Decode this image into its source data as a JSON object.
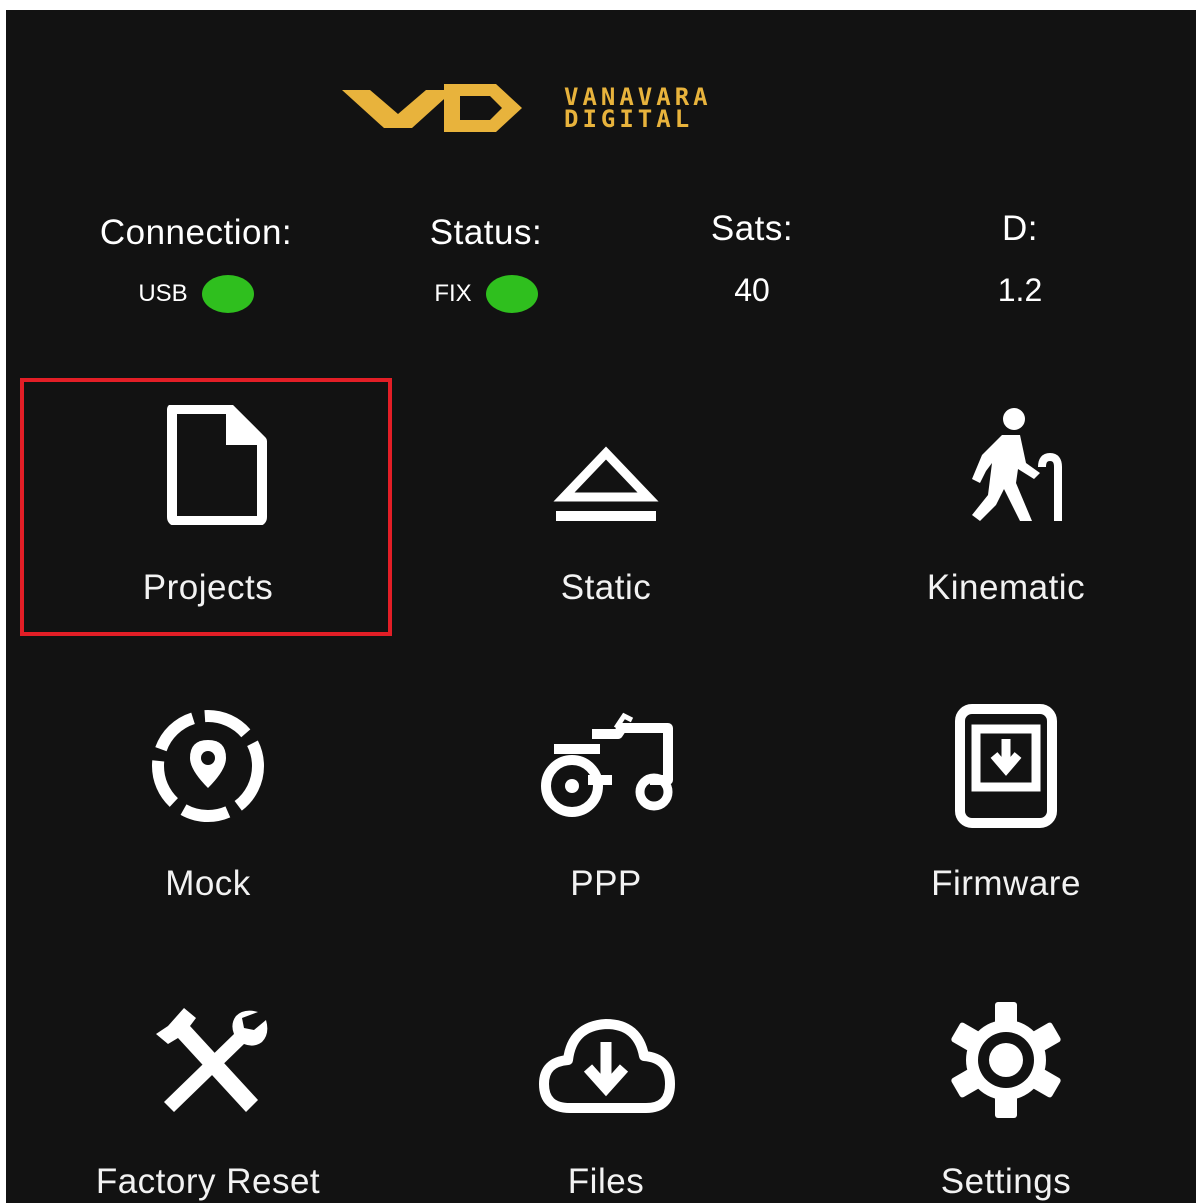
{
  "logo": {
    "mark": "VD",
    "line1": "VANAVARA",
    "line2": "DIGITAL",
    "color": "#e8b33c"
  },
  "status": {
    "connection": {
      "label": "Connection:",
      "value": "USB",
      "indicator_color": "#2fbf1e"
    },
    "fix": {
      "label": "Status:",
      "value": "FIX",
      "indicator_color": "#2fbf1e"
    },
    "sats": {
      "label": "Sats:",
      "value": "40"
    },
    "d": {
      "label": "D:",
      "value": "1.2"
    }
  },
  "menu": [
    {
      "label": "Projects",
      "icon": "document-icon",
      "selected": true
    },
    {
      "label": "Static",
      "icon": "eject-icon"
    },
    {
      "label": "Kinematic",
      "icon": "walking-person-icon"
    },
    {
      "label": "Mock",
      "icon": "location-target-icon"
    },
    {
      "label": "PPP",
      "icon": "tractor-icon"
    },
    {
      "label": "Firmware",
      "icon": "phone-download-icon"
    },
    {
      "label": "Factory Reset",
      "icon": "tools-icon"
    },
    {
      "label": "Files",
      "icon": "cloud-download-icon"
    },
    {
      "label": "Settings",
      "icon": "gear-icon"
    }
  ],
  "colors": {
    "background": "#121212",
    "selection_border": "#e21e26",
    "status_ok": "#2fbf1e"
  }
}
